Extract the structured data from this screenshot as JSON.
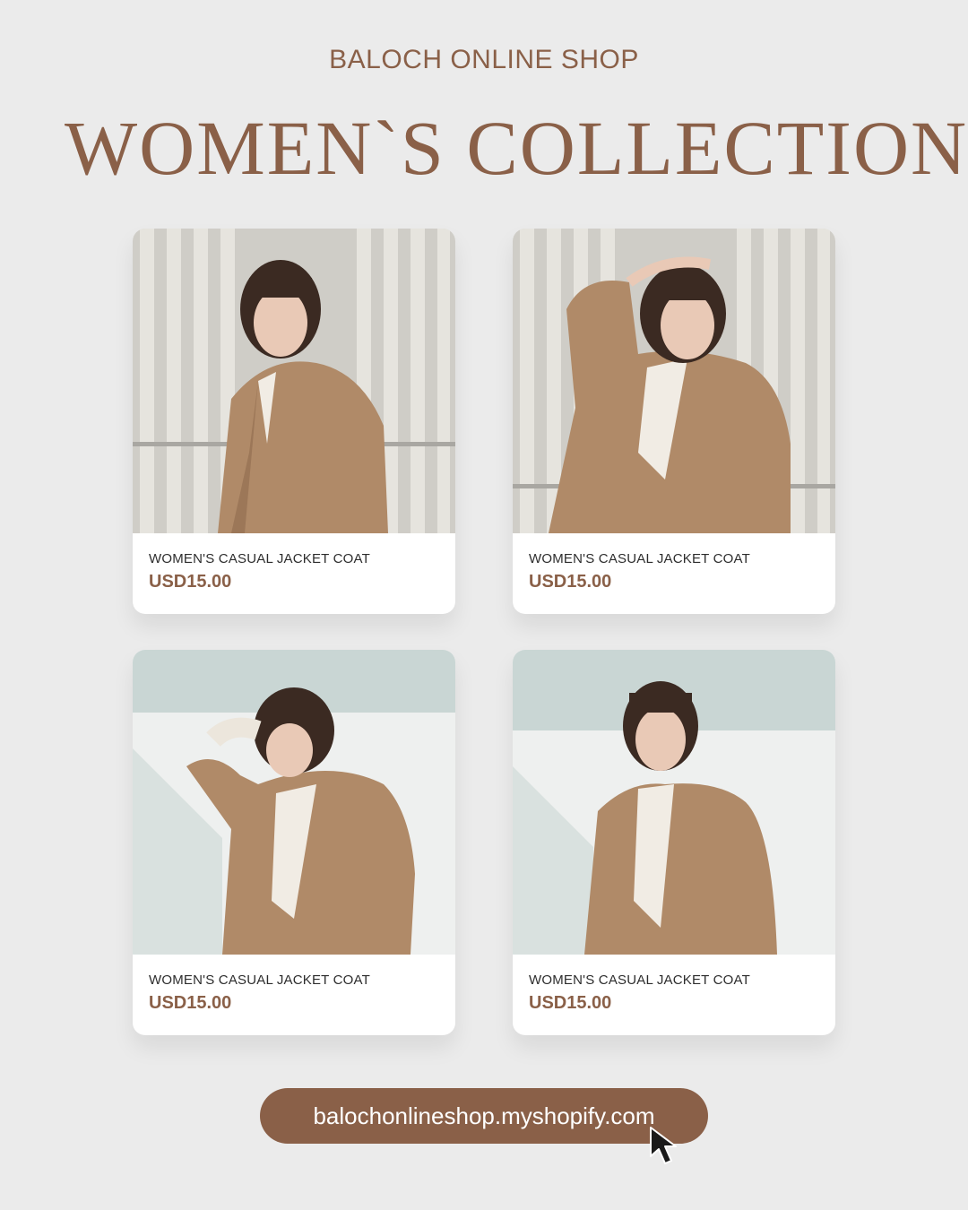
{
  "header": {
    "shop_name": "BALOCH ONLINE SHOP",
    "collection_title": "WOMEN`S COLLECTION"
  },
  "products": [
    {
      "name": "WOMEN'S CASUAL JACKET COAT",
      "price": "USD15.00"
    },
    {
      "name": "WOMEN'S CASUAL JACKET COAT",
      "price": "USD15.00"
    },
    {
      "name": "WOMEN'S CASUAL JACKET COAT",
      "price": "USD15.00"
    },
    {
      "name": "WOMEN'S CASUAL JACKET COAT",
      "price": "USD15.00"
    }
  ],
  "footer": {
    "url": "balochonlineshop.myshopify.com"
  },
  "colors": {
    "background": "#ebebeb",
    "accent_brown": "#8a6048",
    "card": "#ffffff",
    "coat": "#b08a68"
  },
  "icons": [
    "cursor-arrow-icon"
  ]
}
